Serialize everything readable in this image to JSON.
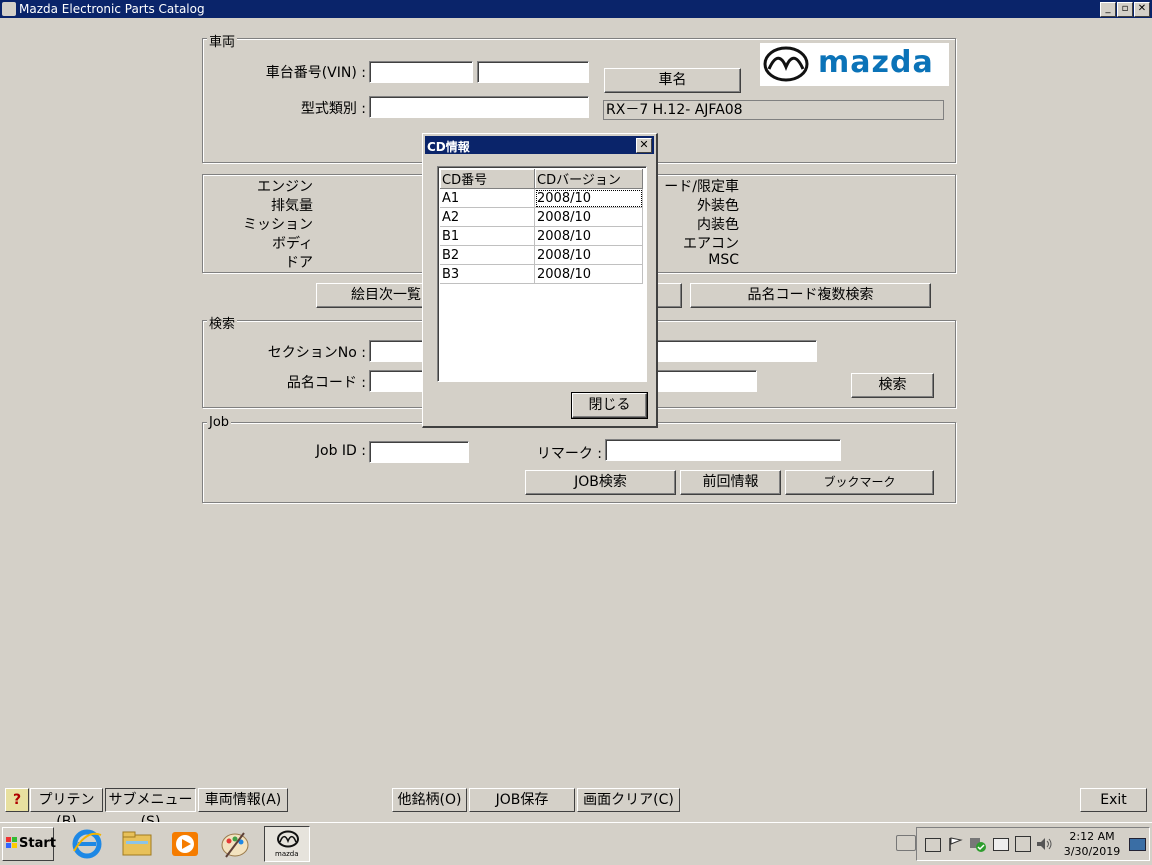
{
  "window": {
    "title": "Mazda Electronic Parts Catalog",
    "min": "_",
    "max": "▫",
    "close": "✕"
  },
  "vehicle": {
    "group_label": "車両",
    "vin_label": "車台番号(VIN) :",
    "model_label": "型式類別 :",
    "carname_button": "車名",
    "model_info": "RX－7 H.12- AJFA08",
    "brand": "mazda"
  },
  "specs": {
    "left_labels": [
      "エンジン",
      "排気量",
      "ミッション",
      "ボディ",
      "ドア"
    ],
    "right_labels": [
      "ード/限定車",
      "外装色",
      "内装色",
      "エアコン",
      "MSC"
    ]
  },
  "buttons_row": {
    "illustration_index": "絵目次一覧",
    "partname_multi": "品名コード複数検索"
  },
  "search": {
    "group_label": "検索",
    "section_label": "セクションNo :",
    "partname_label": "品名コード :",
    "search_button": "検索"
  },
  "job": {
    "group_label": "Job",
    "jobid_label": "Job ID :",
    "remark_label": "リマーク :",
    "job_search": "JOB検索",
    "previous_info": "前回情報",
    "bookmark": "ブックマーク"
  },
  "dialog": {
    "title": "CD情報",
    "close_x": "✕",
    "columns": [
      "CD番号",
      "CDバージョン"
    ],
    "rows": [
      [
        "A1",
        "2008/10"
      ],
      [
        "A2",
        "2008/10"
      ],
      [
        "B1",
        "2008/10"
      ],
      [
        "B2",
        "2008/10"
      ],
      [
        "B3",
        "2008/10"
      ]
    ],
    "close_button": "閉じる"
  },
  "toolbar": {
    "help": "?",
    "print": "プリテン(B)",
    "submenu": "サブメニュー(S)",
    "vehicle_info": "車両情報(A)",
    "other_brand": "他銘柄(O)",
    "job_save": "JOB保存",
    "clear_screen": "画面クリア(C)",
    "exit": "Exit"
  },
  "taskbar": {
    "start": "Start",
    "time": "2:12 AM",
    "date": "3/30/2019",
    "mazda_task": "mazda"
  }
}
